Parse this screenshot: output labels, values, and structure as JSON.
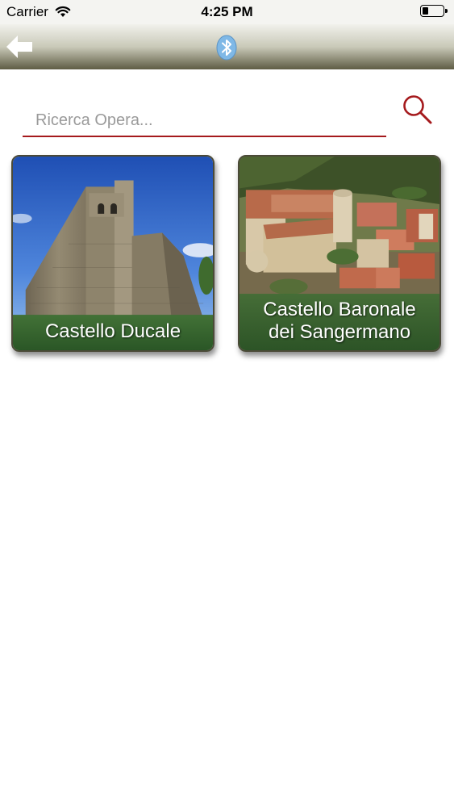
{
  "status_bar": {
    "carrier": "Carrier",
    "time": "4:25 PM"
  },
  "nav_bar": {
    "back_icon": "arrow-left-icon",
    "center_icon": "bluetooth-icon",
    "bluetooth_color": "#7fb8e6"
  },
  "search": {
    "placeholder": "Ricerca Opera...",
    "value": "",
    "icon": "search-icon",
    "accent_color": "#a51a1d"
  },
  "cards": [
    {
      "title": "Castello Ducale"
    },
    {
      "title_line1": "Castello Baronale",
      "title_line2": "dei Sangermano"
    }
  ]
}
